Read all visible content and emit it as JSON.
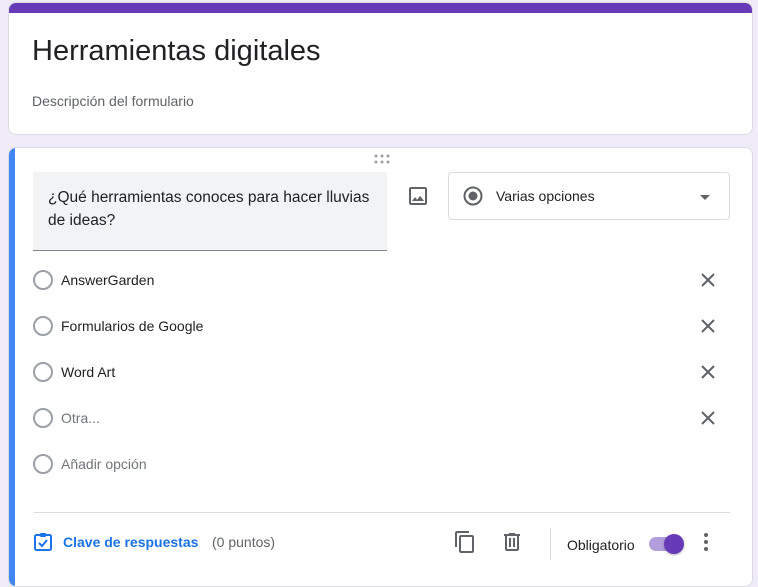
{
  "form": {
    "title": "Herramientas digitales",
    "description_placeholder": "Descripción del formulario"
  },
  "question": {
    "text": "¿Qué herramientas conoces para hacer lluvias de ideas?",
    "type_label": "Varias opciones",
    "options": [
      {
        "label": "AnswerGarden"
      },
      {
        "label": "Formularios de Google"
      },
      {
        "label": "Word Art"
      },
      {
        "label": "Otra..."
      }
    ],
    "add_option_label": "Añadir opción"
  },
  "footer": {
    "answer_key_label": "Clave de respuestas",
    "points_label": "(0 puntos)",
    "required_label": "Obligatorio",
    "required_on": true
  },
  "colors": {
    "accent": "#673ab7",
    "active_bar": "#4285f4",
    "link": "#1a73e8"
  },
  "icons": [
    "image-icon",
    "radio-button-checked-icon",
    "dropdown-arrow-icon",
    "close-icon",
    "answer-key-icon",
    "duplicate-icon",
    "trash-icon",
    "more-vert-icon",
    "drag-handle-icon"
  ]
}
